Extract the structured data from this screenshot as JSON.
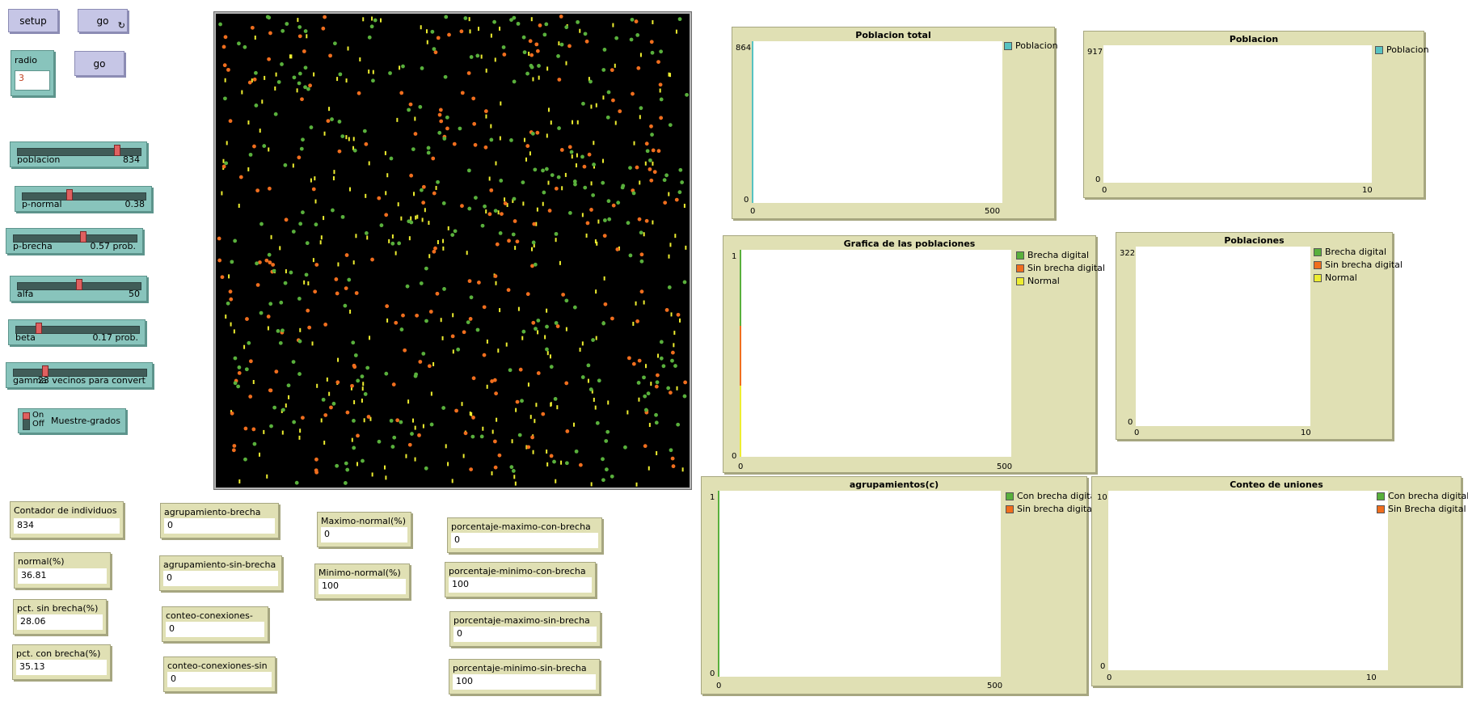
{
  "buttons": {
    "setup": "setup",
    "go_forever": "go",
    "go_forever_icon": "↻",
    "go_once": "go"
  },
  "chooser_radio": {
    "label": "radio",
    "value": "3"
  },
  "sliders": [
    {
      "label": "poblacion",
      "display": "834",
      "fraction": 0.82
    },
    {
      "label": "p-normal",
      "display": "0.38",
      "fraction": 0.38
    },
    {
      "label": "p-brecha",
      "display": "0.57 prob.",
      "fraction": 0.57
    },
    {
      "label": "alfa",
      "display": "50",
      "fraction": 0.5
    },
    {
      "label": "beta",
      "display": "0.17 prob.",
      "fraction": 0.17
    },
    {
      "label": "gamma",
      "display": "23 vecinos para convert",
      "fraction": 0.23
    }
  ],
  "switch": {
    "on": "On",
    "off": "Off",
    "label": "Muestre-grados",
    "state": "off"
  },
  "monitors": {
    "contador": {
      "label": "Contador de individuos",
      "value": "834"
    },
    "normal": {
      "label": "normal(%)",
      "value": "36.81"
    },
    "sin_brecha": {
      "label": "pct. sin brecha(%)",
      "value": "28.06"
    },
    "con_brecha": {
      "label": "pct. con brecha(%)",
      "value": "35.13"
    },
    "agrup_brecha": {
      "label": "agrupamiento-brecha",
      "value": "0"
    },
    "agrup_sin_brecha": {
      "label": "agrupamiento-sin-brecha",
      "value": "0"
    },
    "conteo_con": {
      "label": "conteo-conexiones-con",
      "value": "0"
    },
    "conteo_sin": {
      "label": "conteo-conexiones-sin",
      "value": "0"
    },
    "max_normal": {
      "label": "Maximo-normal(%)",
      "value": "0"
    },
    "min_normal": {
      "label": "Minimo-normal(%)",
      "value": "100"
    },
    "pct_max_con": {
      "label": "porcentaje-maximo-con-brecha",
      "value": "0"
    },
    "pct_min_con": {
      "label": "porcentaje-minimo-con-brecha",
      "value": "100"
    },
    "pct_max_sin": {
      "label": "porcentaje-maximo-sin-brecha",
      "value": "0"
    },
    "pct_min_sin": {
      "label": "porcentaje-minimo-sin-brecha",
      "value": "100"
    }
  },
  "colors": {
    "green": "#59b03c",
    "orange": "#f06e1e",
    "yellow": "#eded30",
    "cyan": "#57c3c2",
    "button": "#c6c6e6",
    "teal": "#88c4bc",
    "monitor": "#e0e0b4"
  },
  "plots": {
    "poblacion_total": {
      "title": "Poblacion total",
      "ymax": "864",
      "ymin": "0",
      "xmin": "0",
      "xmax": "500",
      "legend": [
        {
          "name": "Poblacion",
          "color": "#57c3c2"
        }
      ]
    },
    "poblacion": {
      "title": "Poblacion",
      "ymax": "917",
      "ymin": "0",
      "xmin": "0",
      "xmax": "10",
      "legend": [
        {
          "name": "Poblacion",
          "color": "#57c3c2"
        }
      ]
    },
    "grafica": {
      "title": "Grafica de las poblaciones",
      "ymax": "1",
      "ymin": "0",
      "xmin": "0",
      "xmax": "500",
      "legend": [
        {
          "name": "Brecha digital",
          "color": "#59b03c"
        },
        {
          "name": "Sin brecha digital",
          "color": "#f06e1e"
        },
        {
          "name": "Normal",
          "color": "#eded30"
        }
      ]
    },
    "poblaciones": {
      "title": "Poblaciones",
      "ymax": "322",
      "ymin": "0",
      "xmin": "0",
      "xmax": "10",
      "legend": [
        {
          "name": "Brecha digital",
          "color": "#59b03c"
        },
        {
          "name": "Sin brecha digital",
          "color": "#f06e1e"
        },
        {
          "name": "Normal",
          "color": "#eded30"
        }
      ]
    },
    "agrupamientos": {
      "title": "agrupamientos(c)",
      "ymax": "1",
      "ymin": "0",
      "xmin": "0",
      "xmax": "500",
      "legend": [
        {
          "name": "Con brecha digital",
          "color": "#59b03c"
        },
        {
          "name": "Sin brecha digital",
          "color": "#f06e1e"
        }
      ]
    },
    "conteo": {
      "title": "Conteo de uniones",
      "ymax": "10",
      "ymin": "0",
      "xmin": "0",
      "xmax": "10",
      "legend": [
        {
          "name": "Con brecha digital",
          "color": "#59b03c"
        },
        {
          "name": "Sin Brecha digital",
          "color": "#f06e1e"
        }
      ]
    }
  },
  "world": {
    "population": 834,
    "normal_pct": 36.81,
    "sin_brecha_pct": 28.06,
    "con_brecha_pct": 35.13
  }
}
